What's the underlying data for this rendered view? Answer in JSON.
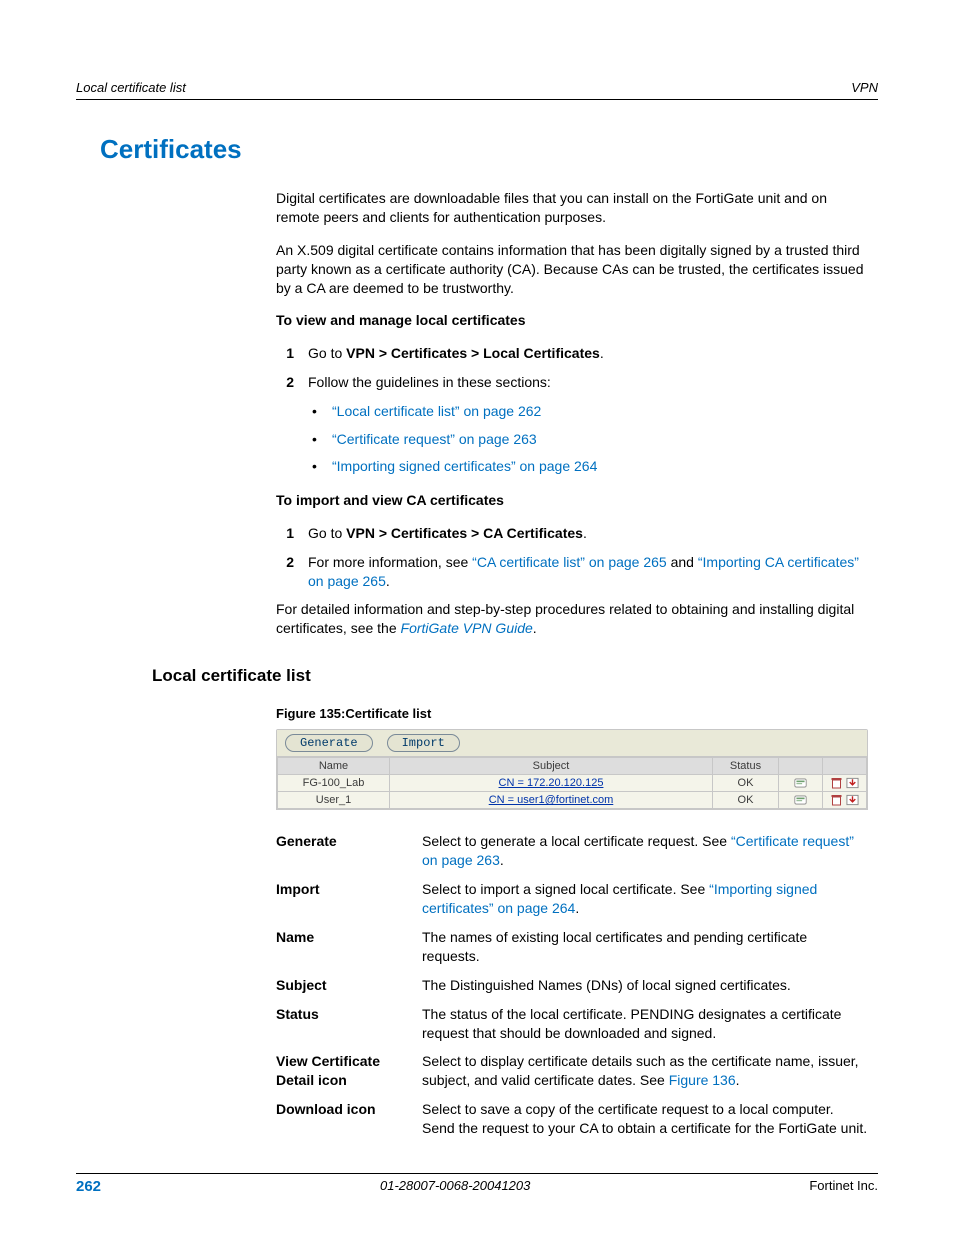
{
  "header": {
    "left": "Local certificate list",
    "right": "VPN"
  },
  "title": "Certificates",
  "intro": {
    "p1": "Digital certificates are downloadable files that you can install on the FortiGate unit and on remote peers and clients for authentication purposes.",
    "p2": "An X.509 digital certificate contains information that has been digitally signed by a trusted third party known as a certificate authority (CA). Because CAs can be trusted, the certificates issued by a CA are deemed to be trustworthy."
  },
  "proc1": {
    "heading": "To view and manage local certificates",
    "step1_num": "1",
    "step1_pre": "Go to ",
    "step1_bold": "VPN > Certificates > Local Certificates",
    "step1_post": ".",
    "step2_num": "2",
    "step2_text": "Follow the guidelines in these sections:",
    "bullets": {
      "b1": "“Local certificate list” on page 262",
      "b2": "“Certificate request” on page 263",
      "b3": "“Importing signed certificates” on page 264"
    }
  },
  "proc2": {
    "heading": "To import and view CA certificates",
    "step1_num": "1",
    "step1_pre": "Go to ",
    "step1_bold": "VPN > Certificates > CA Certificates",
    "step1_post": ".",
    "step2_num": "2",
    "step2_pre": "For more information, see ",
    "step2_link1": "“CA certificate list” on page 265",
    "step2_mid": " and ",
    "step2_link2": "“Importing CA certificates” on page 265",
    "step2_post": "."
  },
  "detail": {
    "pre": "For detailed information and step-by-step procedures related to obtaining and installing digital certificates, see the ",
    "link": "FortiGate VPN Guide",
    "post": "."
  },
  "section2": "Local certificate list",
  "figure_caption": "Figure 135:Certificate list",
  "shot": {
    "btn_generate": "Generate",
    "btn_import": "Import",
    "head_name": "Name",
    "head_subject": "Subject",
    "head_status": "Status",
    "rows": [
      {
        "name": "FG-100_Lab",
        "subject": "CN = 172.20.120.125",
        "status": "OK"
      },
      {
        "name": "User_1",
        "subject": "CN = user1@fortinet.com",
        "status": "OK"
      }
    ]
  },
  "defs": {
    "generate": {
      "term": "Generate",
      "pre": "Select to generate a local certificate request. See ",
      "link": "“Certificate request” on page 263",
      "post": "."
    },
    "import": {
      "term": "Import",
      "pre": "Select to import a signed local certificate. See ",
      "link": "“Importing signed certificates” on page 264",
      "post": "."
    },
    "name": {
      "term": "Name",
      "body": "The names of existing local certificates and pending certificate requests."
    },
    "subject": {
      "term": "Subject",
      "body": "The Distinguished Names (DNs) of local signed certificates."
    },
    "status": {
      "term": "Status",
      "body": "The status of the local certificate. PENDING designates a certificate request that should be downloaded and signed."
    },
    "view": {
      "term": "View Certificate Detail icon",
      "pre": "Select to display certificate details such as the certificate name, issuer, subject, and valid certificate dates. See ",
      "link": "Figure 136",
      "post": "."
    },
    "download": {
      "term": "Download icon",
      "body": "Select to save a copy of the certificate request to a local computer. Send the request to your CA to obtain a certificate for the FortiGate unit."
    }
  },
  "footer": {
    "page": "262",
    "mid": "01-28007-0068-20041203",
    "right": "Fortinet Inc."
  }
}
